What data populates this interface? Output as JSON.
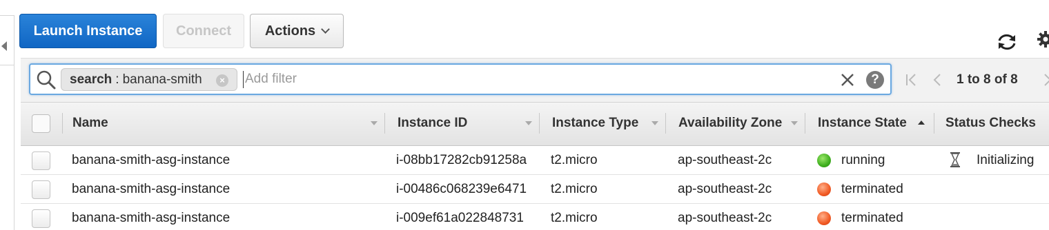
{
  "toolbar": {
    "launch_label": "Launch Instance",
    "connect_label": "Connect",
    "actions_label": "Actions"
  },
  "filter": {
    "chip_key": "search",
    "chip_sep": ":",
    "chip_value": "banana-smith",
    "placeholder": "Add filter"
  },
  "pagination": {
    "label": "1 to 8 of 8"
  },
  "table": {
    "columns": [
      {
        "label": "Name"
      },
      {
        "label": "Instance ID"
      },
      {
        "label": "Instance Type"
      },
      {
        "label": "Availability Zone"
      },
      {
        "label": "Instance State"
      },
      {
        "label": "Status Checks"
      }
    ],
    "rows": [
      {
        "name": "banana-smith-asg-instance",
        "instance_id": "i-08bb17282cb91258a",
        "type": "t2.micro",
        "zone": "ap-southeast-2c",
        "state": "running",
        "state_color": "#3eae1e",
        "status": "Initializing"
      },
      {
        "name": "banana-smith-asg-instance",
        "instance_id": "i-00486c068239e6471",
        "type": "t2.micro",
        "zone": "ap-southeast-2c",
        "state": "terminated",
        "state_color": "#f15a24",
        "status": ""
      },
      {
        "name": "banana-smith-asg-instance",
        "instance_id": "i-009ef61a022848731",
        "type": "t2.micro",
        "zone": "ap-southeast-2c",
        "state": "terminated",
        "state_color": "#f15a24",
        "status": ""
      }
    ]
  },
  "icons": {
    "refresh": "refresh-icon",
    "settings": "gear-icon",
    "search": "search-icon",
    "clear": "close-icon",
    "help": "help-icon",
    "status": "hourglass-icon"
  },
  "colors": {
    "primary": "#1066c4",
    "running": "#3eae1e",
    "terminated": "#f15a24"
  }
}
